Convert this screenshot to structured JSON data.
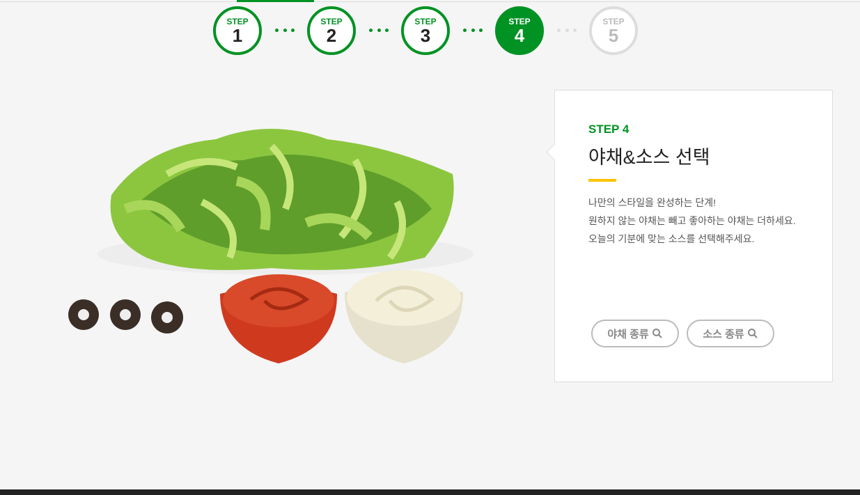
{
  "steps": [
    {
      "label": "STEP",
      "number": "1",
      "state": "done"
    },
    {
      "label": "STEP",
      "number": "2",
      "state": "done"
    },
    {
      "label": "STEP",
      "number": "3",
      "state": "done"
    },
    {
      "label": "STEP",
      "number": "4",
      "state": "active"
    },
    {
      "label": "STEP",
      "number": "5",
      "state": "upcoming"
    }
  ],
  "panel": {
    "step_label": "STEP 4",
    "title": "야채&소스 선택",
    "lines": [
      "나만의 스타일을 완성하는 단계!",
      "원하지 않는 야채는 빼고 좋아하는 야채는 더하세요.",
      "오늘의 기분에 맞는 소스를 선택해주세요."
    ],
    "buttons": [
      "야채 종류",
      "소스 종류"
    ]
  },
  "colors": {
    "accent": "#009223",
    "highlight": "#ffc300"
  }
}
